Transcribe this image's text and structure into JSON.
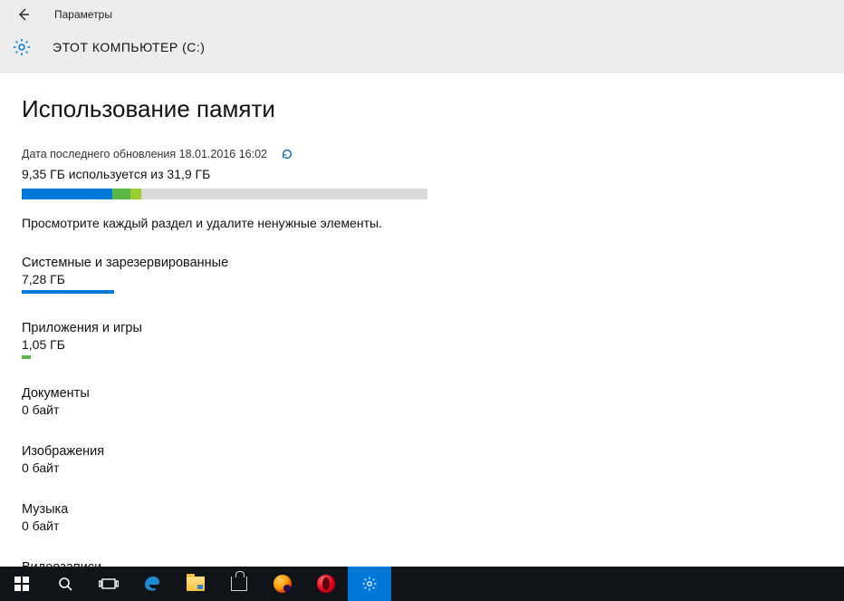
{
  "header": {
    "back_label": "Назад",
    "settings_label": "Параметры",
    "drive_title": "ЭТОТ КОМПЬЮТЕР (C:)"
  },
  "page": {
    "title": "Использование памяти",
    "last_update_label": "Дата последнего обновления",
    "last_update_value": "18.01.2016 16:02",
    "usage_text": "9,35 ГБ используется из 31,9 ГБ",
    "help_text": "Просмотрите каждый раздел и удалите ненужные элементы."
  },
  "categories": [
    {
      "name": "Системные и зарезервированные",
      "value": "7,28 ГБ",
      "color": "#0078d7",
      "bar_class": "fill-system"
    },
    {
      "name": "Приложения и игры",
      "value": "1,05 ГБ",
      "color": "#58b747",
      "bar_class": "fill-apps"
    },
    {
      "name": "Документы",
      "value": "0 байт",
      "color": null,
      "bar_class": ""
    },
    {
      "name": "Изображения",
      "value": "0 байт",
      "color": null,
      "bar_class": ""
    },
    {
      "name": "Музыка",
      "value": "0 байт",
      "color": null,
      "bar_class": ""
    },
    {
      "name": "Видеозаписи",
      "value": "",
      "color": null,
      "bar_class": ""
    }
  ],
  "taskbar": {
    "items": [
      {
        "name": "start",
        "active": false
      },
      {
        "name": "search",
        "active": false
      },
      {
        "name": "task-view",
        "active": false
      },
      {
        "name": "edge",
        "active": false
      },
      {
        "name": "file-explorer",
        "active": false
      },
      {
        "name": "store",
        "active": false
      },
      {
        "name": "firefox",
        "active": false
      },
      {
        "name": "opera",
        "active": false
      },
      {
        "name": "settings",
        "active": true
      }
    ]
  },
  "colors": {
    "accent": "#0078d7",
    "green": "#58b747",
    "lime": "#9acd32",
    "bar_bg": "#d9d9d9",
    "header_bg": "#ededed",
    "taskbar_bg": "#101318"
  },
  "chart_data": {
    "type": "bar",
    "title": "Использование памяти — ЭТОТ КОМПЬЮТЕР (C:)",
    "total_gb": 31.9,
    "used_gb": 9.35,
    "unit": "ГБ",
    "series": [
      {
        "name": "Системные и зарезервированные",
        "value_gb": 7.28,
        "color": "#0078d7"
      },
      {
        "name": "Приложения и игры",
        "value_gb": 1.05,
        "color": "#58b747"
      },
      {
        "name": "Документы",
        "value_gb": 0,
        "color": null
      },
      {
        "name": "Изображения",
        "value_gb": 0,
        "color": null
      },
      {
        "name": "Музыка",
        "value_gb": 0,
        "color": null
      },
      {
        "name": "Видеозаписи",
        "value_gb": 0,
        "color": null
      }
    ]
  }
}
